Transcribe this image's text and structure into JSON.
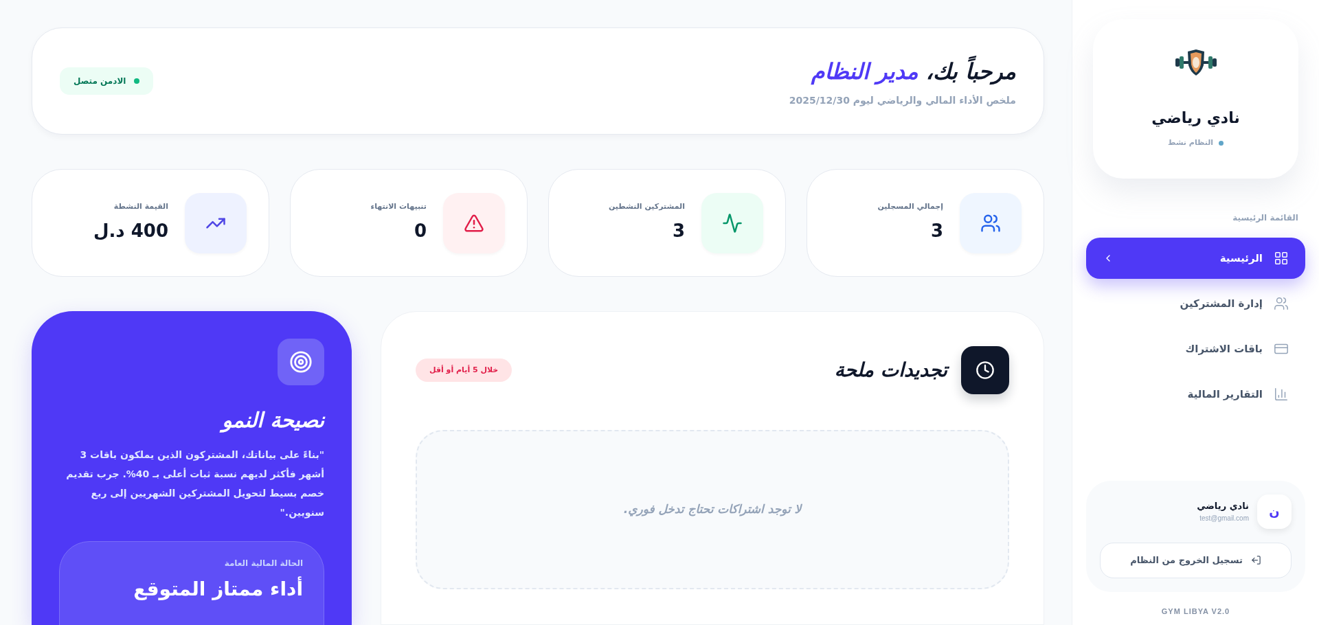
{
  "sidebar": {
    "club_name": "نادي رياضي",
    "status": "النظام نشط",
    "menu_label": "القائمة الرئيسية",
    "items": [
      {
        "label": "الرئيسية",
        "selected": true
      },
      {
        "label": "إدارة المشتركين",
        "selected": false
      },
      {
        "label": "باقات الاشتراك",
        "selected": false
      },
      {
        "label": "التقارير المالية",
        "selected": false
      }
    ],
    "user": {
      "initial": "ن",
      "name": "نادي رياضي",
      "email": "test@gmail.com"
    },
    "logout": "تسجيل الخروج من النظام",
    "version": "GYM LIBYA V2.0"
  },
  "header": {
    "greeting": "مرحباً بك، ",
    "role": "مدير النظام",
    "subtitle": "ملخص الأداء المالي والرياضي ليوم 2025/12/30",
    "badge": "الادمن متصل"
  },
  "stats": [
    {
      "label": "إجمالي المسجلين",
      "value": "3",
      "color": "#2563eb"
    },
    {
      "label": "المشتركين النشطين",
      "value": "3",
      "color": "#059669"
    },
    {
      "label": "تنبيهات الانتهاء",
      "value": "0",
      "color": "#e11d48"
    },
    {
      "label": "القيمة النشطة",
      "value": "400 د.ل",
      "color": "#4f46e5"
    }
  ],
  "renewals": {
    "title": "تجديدات ملحة",
    "badge": "خلال 5 أيام أو أقل",
    "empty": "لا توجد اشتراكات تحتاج تدخل فوري."
  },
  "tip": {
    "title": "نصيحة النمو",
    "text": "\"بناءً على بياناتك، المشتركون الذين يملكون باقات 3 أشهر فأكثر لديهم نسبة ثبات أعلى بـ 40%. جرب تقديم خصم بسيط لتحويل المشتركين الشهريين إلى ربع سنويين.\"",
    "status_label": "الحالة المالية العامة",
    "status_value": "أداء ممتاز المتوقع"
  }
}
